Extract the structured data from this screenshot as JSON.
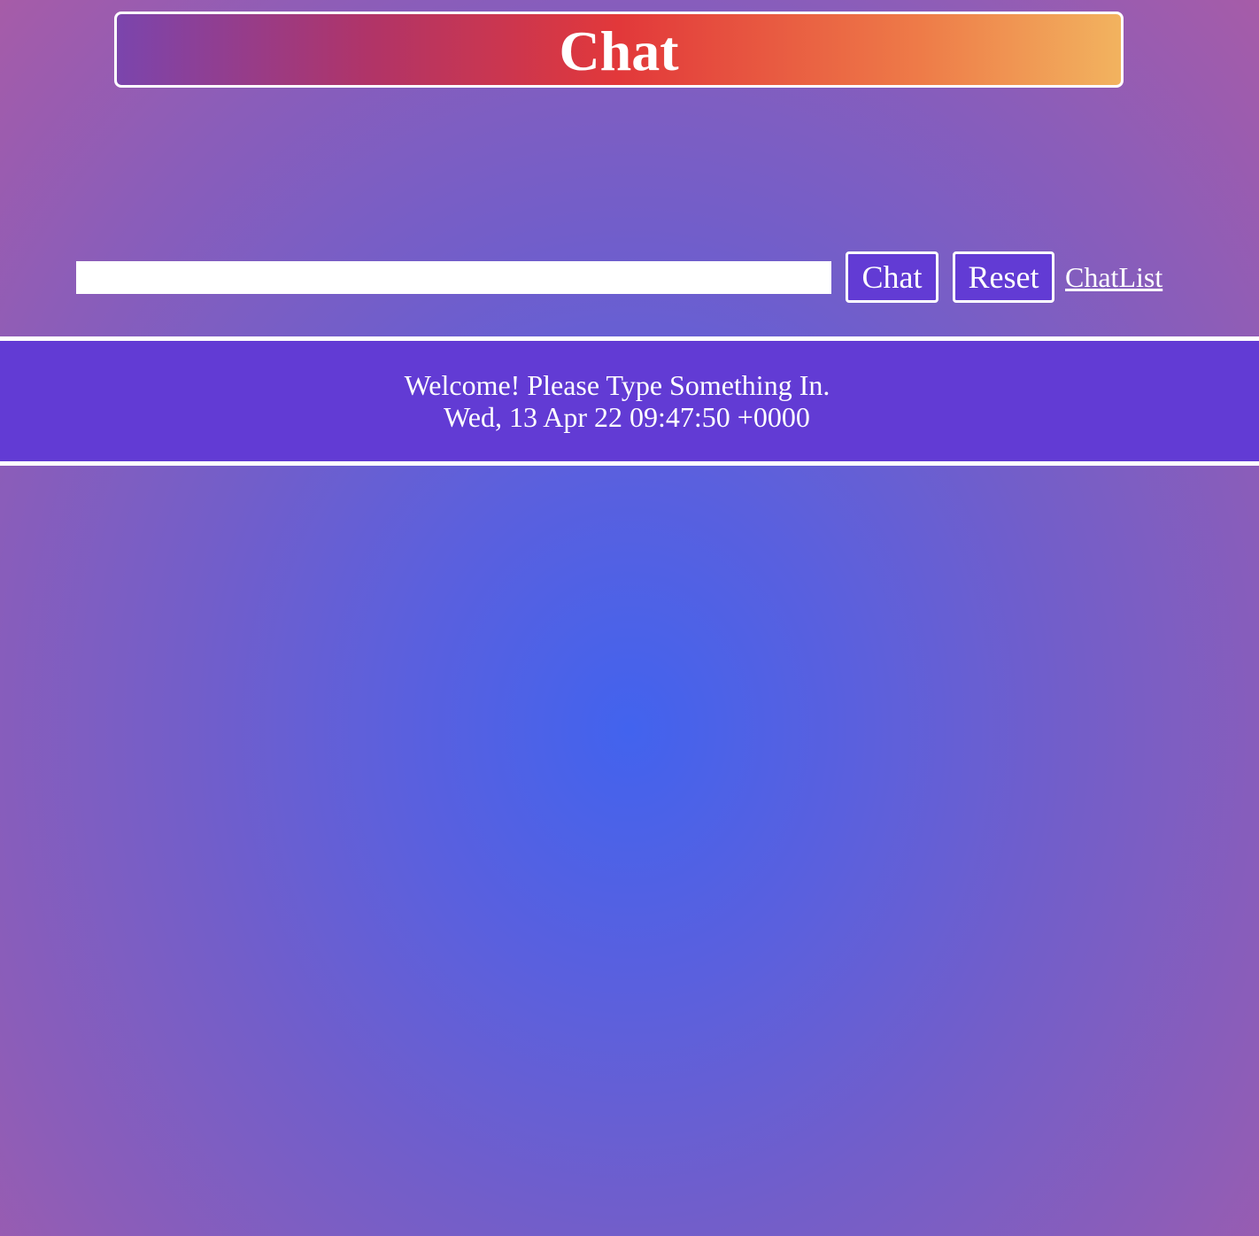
{
  "header": {
    "title": "Chat"
  },
  "chat_form": {
    "input_value": "",
    "input_placeholder": "",
    "chat_button_label": "Chat",
    "reset_button_label": "Reset",
    "chatlist_link_label": "ChatList"
  },
  "messages": [
    {
      "text": "Welcome! Please Type Something In.",
      "timestamp": "Wed, 13 Apr 22 09:47:50 +0000"
    }
  ],
  "colors": {
    "background_center": "#4263ee",
    "background_edge": "#a65ca8",
    "header_gradient_start": "#7b45ad",
    "header_gradient_mid": "#e2383a",
    "header_gradient_end": "#f2b35f",
    "button_background": "#623bd4",
    "message_panel_background": "#623bd4",
    "text": "#ffffff"
  }
}
